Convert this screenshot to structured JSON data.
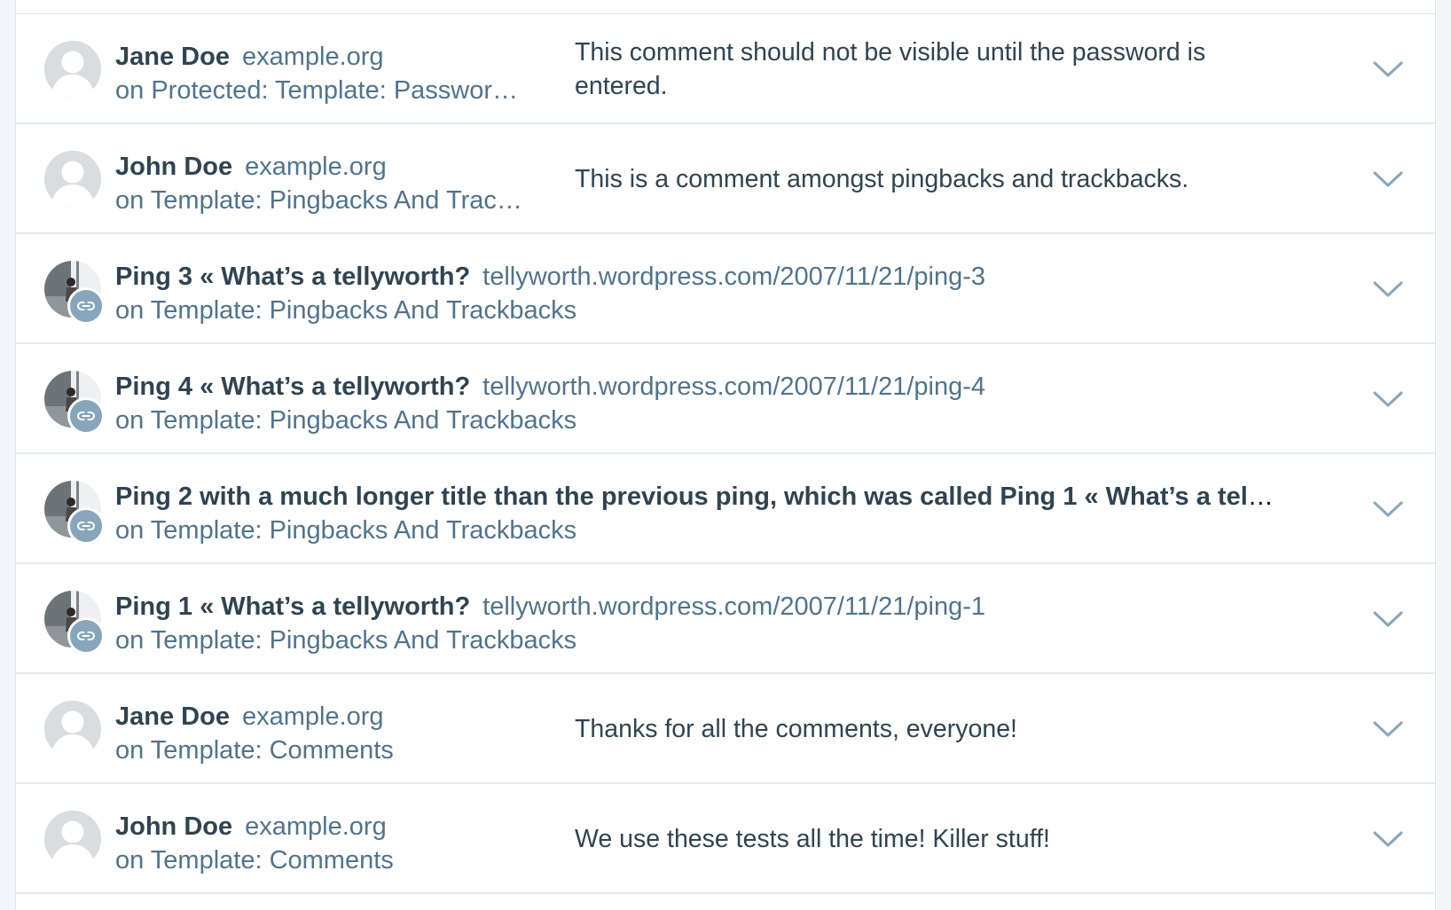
{
  "comments": [
    {
      "author": "Jane Doe",
      "site": "example.org",
      "post": "on Protected: Template: Passwor…",
      "content": "This comment should not be visible until the password is entered.",
      "avatar": "default-avatar-icon",
      "kind": "comment"
    },
    {
      "author": "John Doe",
      "site": "example.org",
      "post": "on Template: Pingbacks And Trac…",
      "content": "This is a comment amongst pingbacks and trackbacks.",
      "avatar": "default-avatar-icon",
      "kind": "comment"
    },
    {
      "author": "Ping 3 « What’s a tellyworth?",
      "site": "tellyworth.wordpress.com/2007/11/21/ping-3",
      "post": "on Template: Pingbacks And Trackbacks",
      "avatar": "site-photo-icon",
      "badge": "link-icon",
      "kind": "ping"
    },
    {
      "author": "Ping 4 « What’s a tellyworth?",
      "site": "tellyworth.wordpress.com/2007/11/21/ping-4",
      "post": "on Template: Pingbacks And Trackbacks",
      "avatar": "site-photo-icon",
      "badge": "link-icon",
      "kind": "ping"
    },
    {
      "author": "Ping 2 with a much longer title than the previous ping, which was called Ping 1 « What’s a tellywo…",
      "site": "",
      "post": "on Template: Pingbacks And Trackbacks",
      "avatar": "site-photo-icon",
      "badge": "link-icon",
      "kind": "ping"
    },
    {
      "author": "Ping 1 « What’s a tellyworth?",
      "site": "tellyworth.wordpress.com/2007/11/21/ping-1",
      "post": "on Template: Pingbacks And Trackbacks",
      "avatar": "site-photo-icon",
      "badge": "link-icon",
      "kind": "ping"
    },
    {
      "author": "Jane Doe",
      "site": "example.org",
      "post": "on Template: Comments",
      "content": "Thanks for all the comments, everyone!",
      "avatar": "default-avatar-icon",
      "kind": "comment"
    },
    {
      "author": "John Doe",
      "site": "example.org",
      "post": "on Template: Comments",
      "content": "We use these tests all the time! Killer stuff!",
      "avatar": "default-avatar-icon",
      "kind": "comment"
    }
  ],
  "expand_icon": "chevron-down-icon",
  "colors": {
    "author": "#2e4453",
    "link": "#4f748e",
    "badge": "#87a6bc",
    "divider": "#e4e9ee",
    "background": "#f3f6f8"
  }
}
